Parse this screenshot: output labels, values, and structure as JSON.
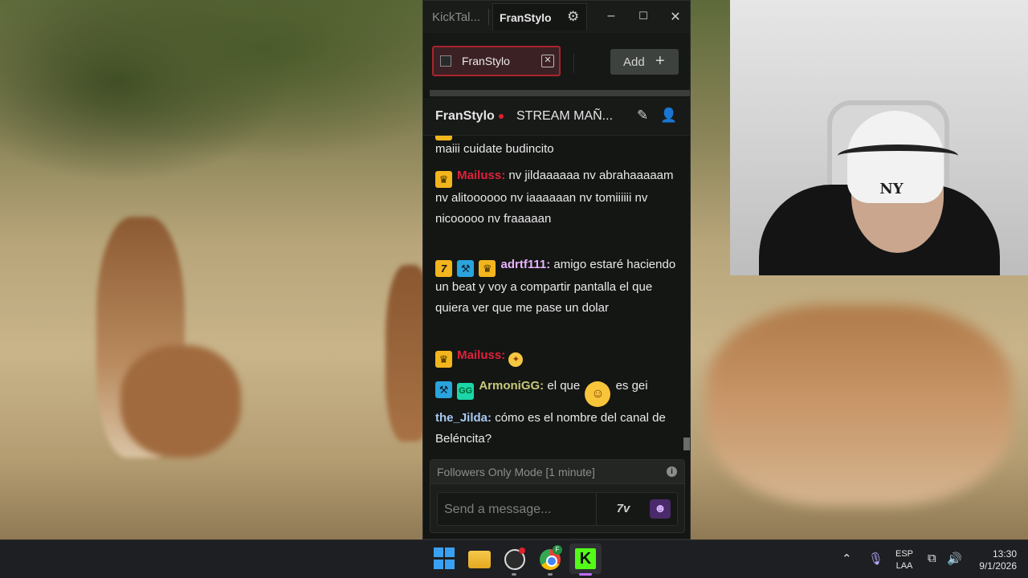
{
  "window": {
    "app_title": "KickTal...",
    "active_tab": "FranStylo"
  },
  "channels": {
    "tab_label": "FranStylo",
    "add_label": "Add"
  },
  "chat_header": {
    "channel": "FranStylo",
    "stream_title": "STREAM MAÑ..."
  },
  "messages": [
    {
      "user": "",
      "text": "maiii cuidate budincito"
    },
    {
      "user": "Mailuss:",
      "text": "nv jildaaaaaa nv abrahaaaaam nv alitoooooo nv iaaaaaan nv tomiiiiii nv nicooooo nv fraaaaan",
      "user_color": "#e0213a"
    },
    {
      "user": "adrtf111:",
      "text": "amigo estaré haciendo un beat y voy a compartir pantalla el que quiera ver que me pase un dolar",
      "user_color": "#e9b3ff"
    },
    {
      "user": "Mailuss:",
      "text": "",
      "user_color": "#e0213a"
    },
    {
      "user": "ArmoniGG:",
      "text_before": "el que",
      "text_after": "es gei",
      "user_color": "#c8c87a"
    },
    {
      "user": "the_Jilda:",
      "text": "cómo es el nombre del canal de Beléncita?",
      "user_color": "#a8c8f0"
    }
  ],
  "composer": {
    "mode_text": "Followers Only Mode [1 minute]",
    "placeholder": "Send a message..."
  },
  "taskbar": {
    "lang_top": "ESP",
    "lang_bottom": "LAA",
    "time": "13:30",
    "date": "9/1/2026"
  },
  "colors": {
    "kick_green": "#53fc18",
    "live_red": "#e01f2a",
    "channel_tab_border": "#a8252c"
  },
  "icons": {
    "settings": "gear-icon",
    "minimize": "minimize-icon",
    "maximize": "maximize-icon",
    "close": "close-icon",
    "add": "plus-icon",
    "header_left": "rocket-icon",
    "header_right": "user-icon",
    "info": "info-icon"
  }
}
